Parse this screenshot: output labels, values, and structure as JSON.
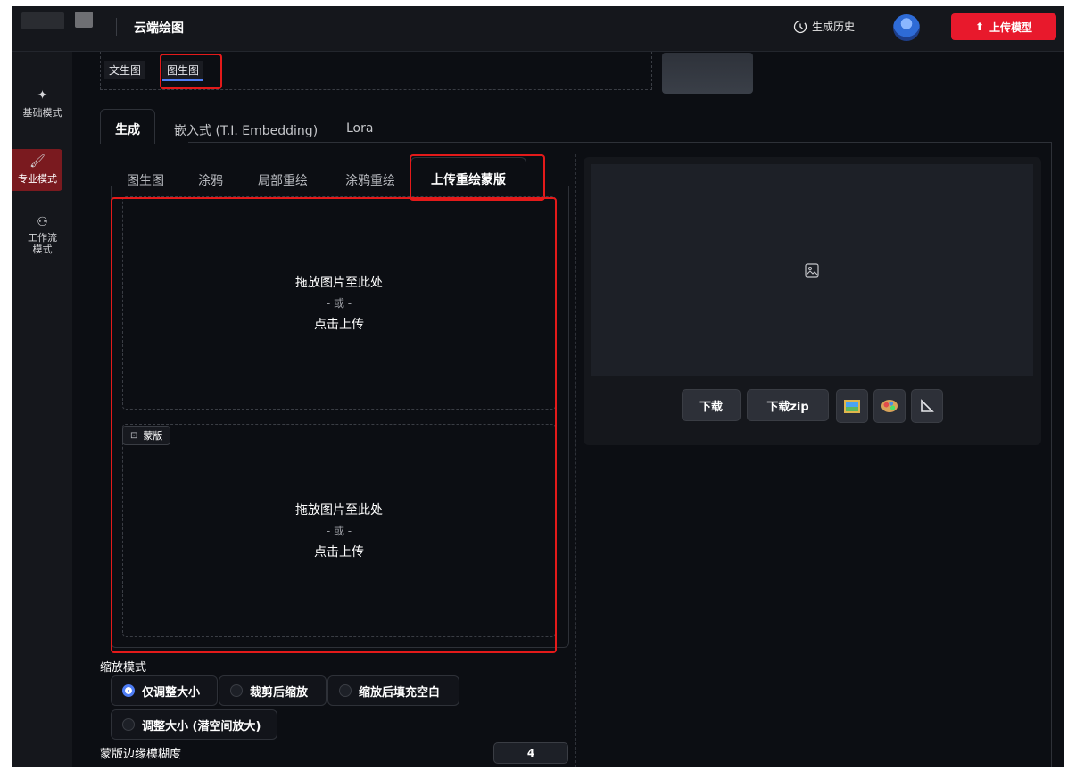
{
  "header": {
    "app_title": "云端绘图",
    "history_label": "生成历史",
    "upload_model_label": "上传模型"
  },
  "sidebar": {
    "items": [
      {
        "label": "基础模式",
        "icon": "sparkle-icon"
      },
      {
        "label": "专业模式",
        "icon": "brush-icon",
        "active": true
      },
      {
        "label": "工作流模式",
        "icon": "workflow-icon"
      }
    ]
  },
  "mode_strip": {
    "tabs": [
      "文生图",
      "图生图"
    ],
    "selected": "图生图"
  },
  "primary_tabs": {
    "items": [
      "生成",
      "嵌入式 (T.I. Embedding)",
      "Lora"
    ],
    "selected": "生成"
  },
  "img2img_tabs": {
    "items": [
      "图生图",
      "涂鸦",
      "局部重绘",
      "涂鸦重绘",
      "上传重绘蒙版"
    ],
    "selected": "上传重绘蒙版"
  },
  "upload_image": {
    "drop_text": "拖放图片至此处",
    "or_text": "- 或 -",
    "click_text": "点击上传"
  },
  "upload_mask": {
    "label": "蒙版",
    "drop_text": "拖放图片至此处",
    "or_text": "- 或 -",
    "click_text": "点击上传"
  },
  "output": {
    "download_label": "下载",
    "download_zip_label": "下载zip",
    "icon_buttons": [
      "picture-icon",
      "palette-icon",
      "ruler-icon"
    ]
  },
  "resize_mode": {
    "label": "缩放模式",
    "options": [
      "仅调整大小",
      "裁剪后缩放",
      "缩放后填充空白",
      "调整大小 (潜空间放大)"
    ],
    "selected": "仅调整大小"
  },
  "mask_blur": {
    "label": "蒙版边缘模糊度",
    "value": "4"
  },
  "colors": {
    "accent_red": "#e8192c",
    "accent_blue": "#4e7df5",
    "background": "#0c0e13",
    "highlight_box": "#e41a1a"
  }
}
